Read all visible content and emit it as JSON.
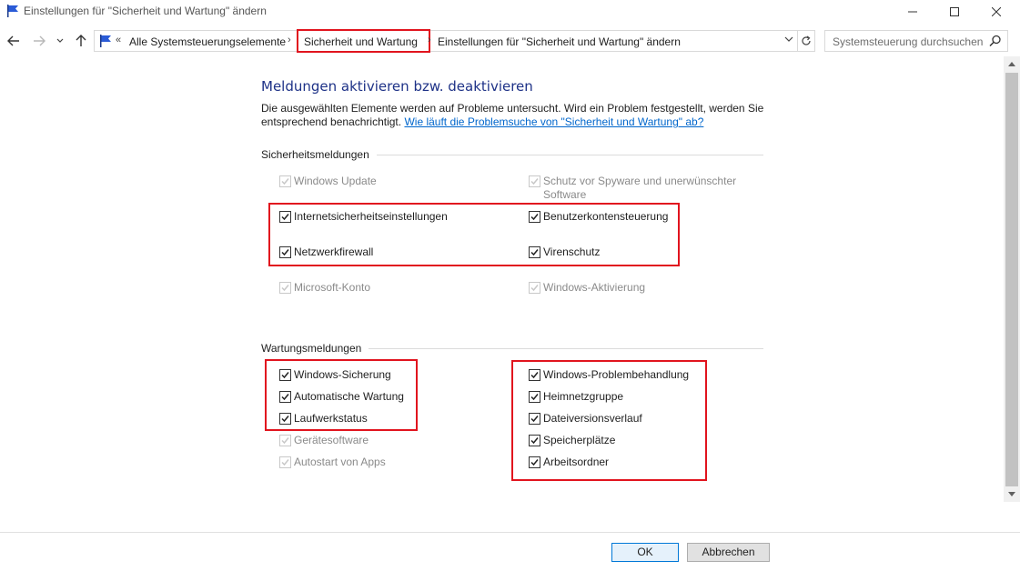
{
  "window": {
    "title": "Einstellungen für \"Sicherheit und Wartung\" ändern"
  },
  "address": {
    "crumb_prefix": "«",
    "crumb1": "Alle Systemsteuerungselemente",
    "crumb2": "Sicherheit und Wartung",
    "crumb3": "Einstellungen für \"Sicherheit und Wartung\" ändern",
    "separator": "›"
  },
  "search": {
    "placeholder": "Systemsteuerung durchsuchen"
  },
  "main": {
    "heading": "Meldungen aktivieren bzw. deaktivieren",
    "description": "Die ausgewählten Elemente werden auf Probleme untersucht. Wird ein Problem festgestellt, werden Sie entsprechend benachrichtigt.",
    "help_link": "Wie läuft die Problemsuche von \"Sicherheit und Wartung\" ab?"
  },
  "security": {
    "section_label": "Sicherheitsmeldungen",
    "items": [
      {
        "label": "Windows Update",
        "checked": true,
        "enabled": false
      },
      {
        "label": "Schutz vor Spyware und unerwünschter Software",
        "checked": true,
        "enabled": false
      },
      {
        "label": "Internetsicherheitseinstellungen",
        "checked": true,
        "enabled": true
      },
      {
        "label": "Benutzerkontensteuerung",
        "checked": true,
        "enabled": true
      },
      {
        "label": "Netzwerkfirewall",
        "checked": true,
        "enabled": true
      },
      {
        "label": "Virenschutz",
        "checked": true,
        "enabled": true
      },
      {
        "label": "Microsoft-Konto",
        "checked": true,
        "enabled": false
      },
      {
        "label": "Windows-Aktivierung",
        "checked": true,
        "enabled": false
      }
    ]
  },
  "maintenance": {
    "section_label": "Wartungsmeldungen",
    "items": [
      {
        "label": "Windows-Sicherung",
        "checked": true,
        "enabled": true
      },
      {
        "label": "Automatische Wartung",
        "checked": true,
        "enabled": true
      },
      {
        "label": "Laufwerkstatus",
        "checked": true,
        "enabled": true
      },
      {
        "label": "Gerätesoftware",
        "checked": true,
        "enabled": false
      },
      {
        "label": "Autostart von Apps",
        "checked": true,
        "enabled": false
      },
      {
        "label": "Windows-Problembehandlung",
        "checked": true,
        "enabled": true
      },
      {
        "label": "Heimnetzgruppe",
        "checked": true,
        "enabled": true
      },
      {
        "label": "Dateiversionsverlauf",
        "checked": true,
        "enabled": true
      },
      {
        "label": "Speicherplätze",
        "checked": true,
        "enabled": true
      },
      {
        "label": "Arbeitsordner",
        "checked": true,
        "enabled": true
      }
    ]
  },
  "buttons": {
    "ok": "OK",
    "cancel": "Abbrechen"
  },
  "colors": {
    "heading": "#1e3287",
    "link": "#0066cc",
    "highlight": "#e1141e"
  }
}
